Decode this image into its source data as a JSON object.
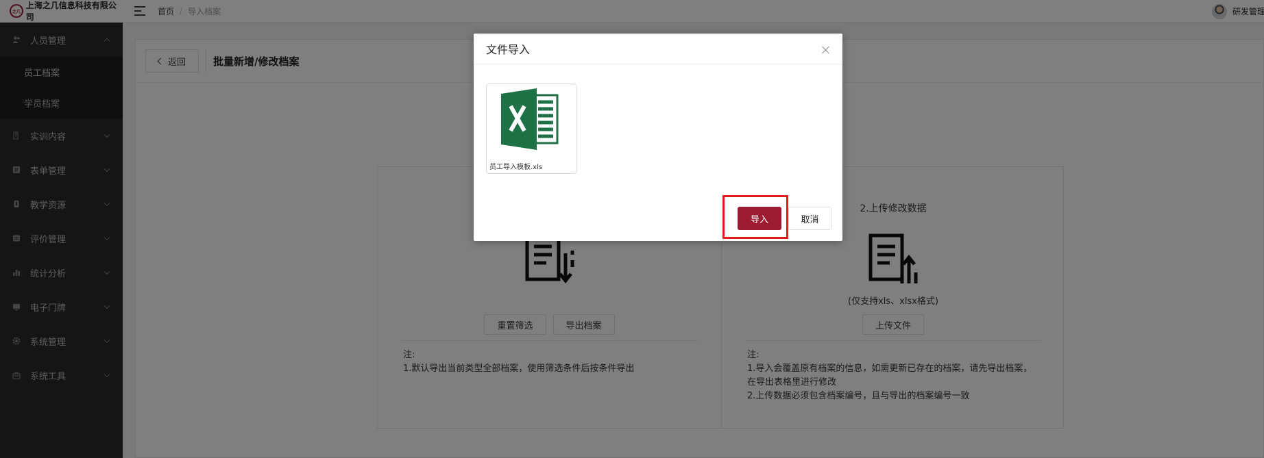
{
  "header": {
    "logo_mark": "之几",
    "company": "上海之几信息科技有限公司",
    "breadcrumb": {
      "home": "首页",
      "sep": "/",
      "current": "导入档案"
    },
    "user_name": "研发管理"
  },
  "sidebar": {
    "items": [
      {
        "label": "人员管理",
        "icon": "people-icon",
        "expanded": true,
        "children": [
          "员工档案",
          "学员档案"
        ]
      },
      {
        "label": "实训内容",
        "icon": "content-icon"
      },
      {
        "label": "表单管理",
        "icon": "form-icon"
      },
      {
        "label": "教学资源",
        "icon": "resource-icon"
      },
      {
        "label": "评价管理",
        "icon": "evaluation-icon"
      },
      {
        "label": "统计分析",
        "icon": "chart-icon"
      },
      {
        "label": "电子门牌",
        "icon": "monitor-icon"
      },
      {
        "label": "系统管理",
        "icon": "gear-icon"
      },
      {
        "label": "系统工具",
        "icon": "toolbox-icon"
      }
    ]
  },
  "page": {
    "back_label": "返回",
    "title": "批量新增/修改档案",
    "right": {
      "title": "2.上传修改数据",
      "support": "(仅支持xls、xlsx格式)",
      "upload_label": "上传文件",
      "notes": [
        "注:",
        "1.导入会覆盖原有档案的信息，如需更新已存在的档案，请先导出档案，在导出表格里进行修改",
        "2.上传数据必须包含档案编号，且与导出的档案编号一致"
      ]
    },
    "left": {
      "reset_label": "重置筛选",
      "export_label": "导出档案",
      "notes": [
        "注:",
        "1.默认导出当前类型全部档案，使用筛选条件后按条件导出"
      ]
    }
  },
  "dialog": {
    "title": "文件导入",
    "file_name": "员工导入模板.xls",
    "import_label": "导入",
    "cancel_label": "取消"
  },
  "colors": {
    "accent": "#9b1b30",
    "sidebar_bg": "#2b2b2b",
    "highlight": "#e11d1d",
    "excel_green": "#1e7145"
  }
}
